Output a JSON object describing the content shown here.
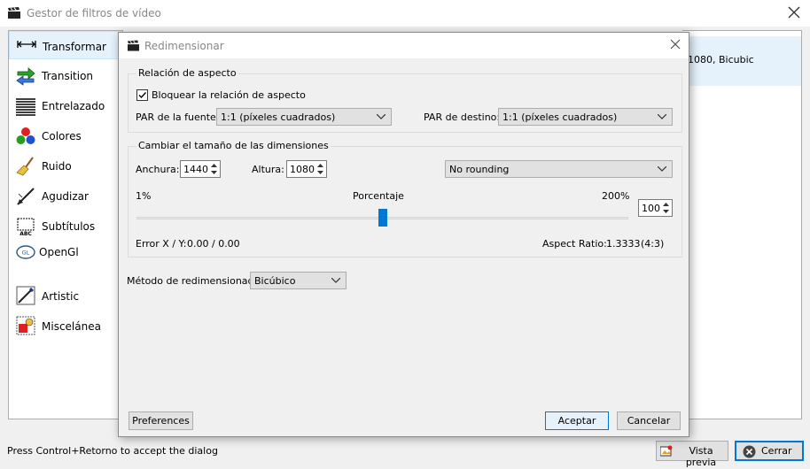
{
  "outer_window": {
    "title": "Gestor de filtros de vídeo",
    "filters": [
      {
        "label": "Transformar",
        "icon": "transform-arrows-icon",
        "selected": true
      },
      {
        "label": "Transition",
        "icon": "transition-arrows-icon",
        "selected": false
      },
      {
        "label": "Entrelazado",
        "icon": "interlace-lines-icon",
        "selected": false
      },
      {
        "label": "Colores",
        "icon": "color-balls-icon",
        "selected": false
      },
      {
        "label": "Ruido",
        "icon": "broom-icon",
        "selected": false
      },
      {
        "label": "Agudizar",
        "icon": "sharpen-icon",
        "selected": false
      },
      {
        "label": "Subtítulos",
        "icon": "subtitles-icon",
        "selected": false
      },
      {
        "label": "OpenGl",
        "icon": "opengl-icon",
        "selected": false
      },
      {
        "label": "Artistic",
        "icon": "artistic-brush-icon",
        "selected": false
      },
      {
        "label": "Miscelánea",
        "icon": "misc-shapes-icon",
        "selected": false
      }
    ],
    "active_filter_summary": "1080, Bicubic",
    "status": "Press Control+Retorno to accept the dialog",
    "preview_button": "Vista previa",
    "close_button": "Cerrar"
  },
  "dialog": {
    "title": "Redimensionar",
    "aspect_group": {
      "title": "Relación de aspecto",
      "lock_label": "Bloquear la relación de aspecto",
      "lock_checked": true,
      "source_par_label": "PAR de la fuente:",
      "source_par_value": "1:1 (píxeles cuadrados)",
      "dest_par_label": "PAR de destino:",
      "dest_par_value": "1:1 (píxeles cuadrados)"
    },
    "size_group": {
      "title": "Cambiar el tamaño de las dimensiones",
      "width_label": "Anchura:",
      "width_value": "1440",
      "height_label": "Altura:",
      "height_value": "1080",
      "rounding_value": "No rounding",
      "min_label": "1%",
      "percent_label": "Porcentaje",
      "max_label": "200%",
      "percent_value": "100",
      "slider_fraction": 0.5,
      "error_label": "Error X / Y:",
      "error_value": "0.00 / 0.00",
      "aspect_ratio_label": "Aspect Ratio:",
      "aspect_ratio_value": "1.3333",
      "aspect_ratio_fraction": "(4:3)"
    },
    "method_label": "Método de redimensionado:",
    "method_value": "Bicúbico",
    "preferences_button": "Preferences",
    "accept_button": "Aceptar",
    "cancel_button": "Cancelar"
  },
  "colors": {
    "accent": "#0078d7",
    "selection": "#e5f1fb"
  }
}
